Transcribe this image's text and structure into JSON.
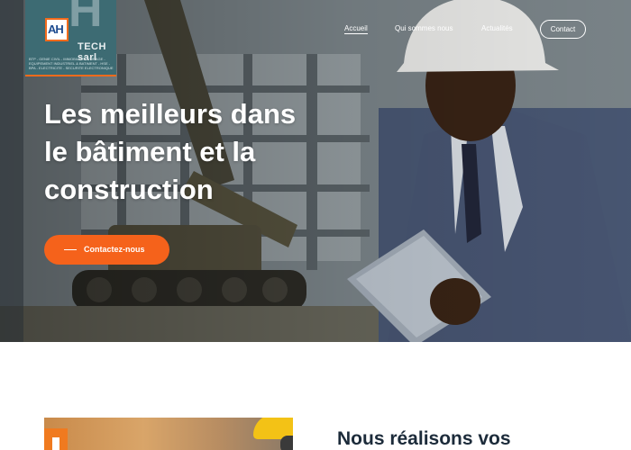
{
  "brand": {
    "logo_mark": "AH",
    "logo_name": "TECH sarl",
    "logo_tagline": "BTP - GENIE CIVIL - IMMOBILIER - FORAGE - EQUIPEMENT INDUSTRIEL & BATIMENT - HSE - BPA - ELECTRICITE - SECURITE ELECTRONIQUE"
  },
  "nav": {
    "home": "Accueil",
    "about": "Qui sommes nous",
    "news": "Actualités",
    "contact": "Contact"
  },
  "hero": {
    "headline_line1": "Les meilleurs dans",
    "headline_line2": "le bâtiment et la",
    "headline_line3": "construction",
    "cta_label": "Contactez-nous"
  },
  "about": {
    "title": "Nous réalisons vos"
  },
  "colors": {
    "accent": "#f5621b",
    "logo_bg": "#3d6b73",
    "heading": "#1c2b3a"
  }
}
